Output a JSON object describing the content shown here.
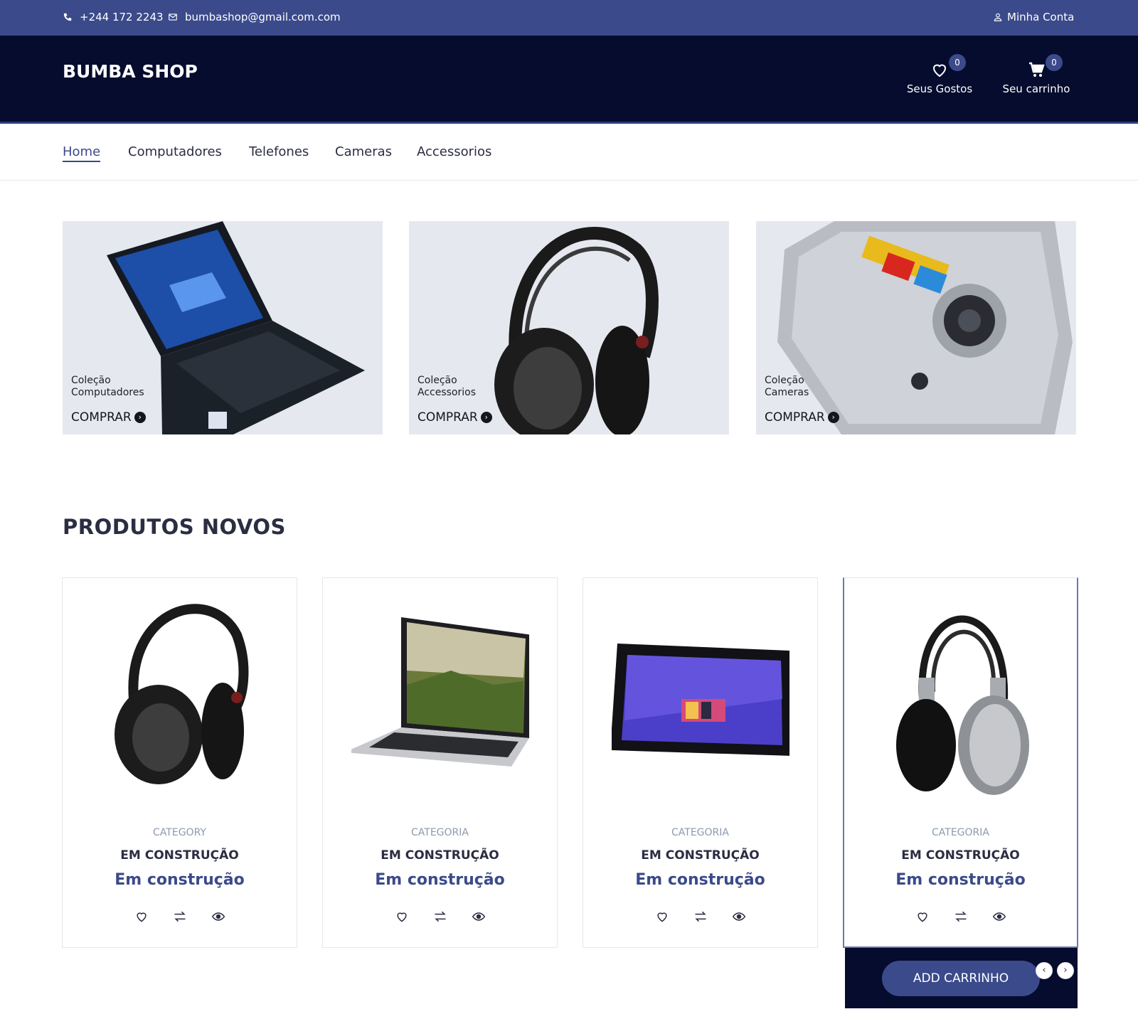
{
  "topbar": {
    "phone": "+244 172 2243",
    "email": "bumbashop@gmail.com.com",
    "account": "Minha Conta"
  },
  "header": {
    "logo": "BUMBA SHOP",
    "wishlist": {
      "label": "Seus Gostos",
      "count": "0"
    },
    "cart": {
      "label": "Seu carrinho",
      "count": "0"
    }
  },
  "nav": {
    "items": [
      "Home",
      "Computadores",
      "Telefones",
      "Cameras",
      "Accessorios"
    ],
    "active": "Home"
  },
  "collections": [
    {
      "line1": "Coleção",
      "line2": "Computadores",
      "cta": "COMPRAR"
    },
    {
      "line1": "Coleção",
      "line2": "Accessorios",
      "cta": "COMPRAR"
    },
    {
      "line1": "Coleção",
      "line2": "Cameras",
      "cta": "COMPRAR"
    }
  ],
  "section": {
    "title": "PRODUTOS NOVOS"
  },
  "products": [
    {
      "category": "CATEGORY",
      "name": "EM CONSTRUÇÃO",
      "price": "Em construção"
    },
    {
      "category": "CATEGORIA",
      "name": "EM CONSTRUÇÃO",
      "price": "Em construção"
    },
    {
      "category": "CATEGORIA",
      "name": "EM CONSTRUÇÃO",
      "price": "Em construção"
    },
    {
      "category": "CATEGORIA",
      "name": "EM CONSTRUÇÃO",
      "price": "Em construção"
    }
  ],
  "add_to_cart": "ADD CARRINHO",
  "colors": {
    "accent": "#3b4a8a",
    "header_bg": "#050c2e",
    "banner_bg": "#e6e8ef"
  }
}
